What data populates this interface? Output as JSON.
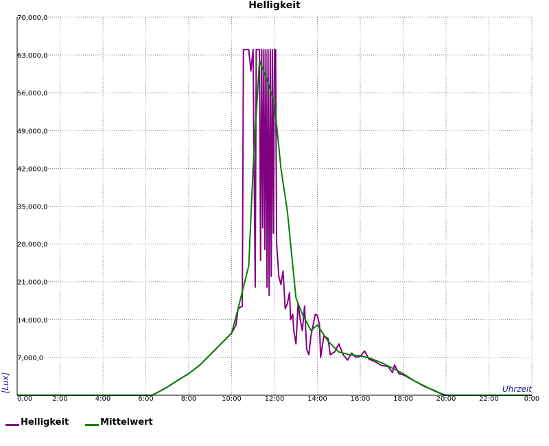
{
  "chart_data": {
    "type": "line",
    "title": "Helligkeit",
    "xlabel": "Uhrzeit",
    "ylabel": "[Lux]",
    "xlim": [
      0,
      24
    ],
    "ylim": [
      0,
      70000
    ],
    "grid": true,
    "legend_position": "bottom-left",
    "y_ticks": [
      "0,00",
      "7,000,0",
      "14,000,0",
      "21,000,0",
      "28,000,0",
      "35,000,0",
      "42,000,0",
      "49,000,0",
      "56,000,0",
      "63,000,0",
      "70,000,0"
    ],
    "x_ticks": [
      "0,00",
      "2:00",
      "4:00",
      "6:00",
      "8:00",
      "10:00",
      "12:00",
      "14:00",
      "16:00",
      "18:00",
      "20:00",
      "22:00",
      "0:00"
    ],
    "series": [
      {
        "name": "Helligkeit",
        "color": "#800080",
        "points": [
          [
            0,
            0
          ],
          [
            6.3,
            0
          ],
          [
            7.0,
            1500
          ],
          [
            7.5,
            2800
          ],
          [
            8.0,
            4000
          ],
          [
            8.5,
            5500
          ],
          [
            9.0,
            7500
          ],
          [
            9.5,
            9500
          ],
          [
            10.0,
            11500
          ],
          [
            10.2,
            13000
          ],
          [
            10.3,
            16000
          ],
          [
            10.5,
            16500
          ],
          [
            10.55,
            64000
          ],
          [
            10.8,
            64000
          ],
          [
            10.9,
            60000
          ],
          [
            11.0,
            64000
          ],
          [
            11.1,
            20000
          ],
          [
            11.15,
            64000
          ],
          [
            11.3,
            64000
          ],
          [
            11.35,
            25000
          ],
          [
            11.4,
            64000
          ],
          [
            11.45,
            31000
          ],
          [
            11.5,
            64000
          ],
          [
            11.55,
            27000
          ],
          [
            11.6,
            64000
          ],
          [
            11.65,
            20000
          ],
          [
            11.7,
            64000
          ],
          [
            11.75,
            18500
          ],
          [
            11.8,
            64000
          ],
          [
            11.85,
            22000
          ],
          [
            11.9,
            64000
          ],
          [
            11.95,
            30000
          ],
          [
            12.0,
            64000
          ],
          [
            12.05,
            64000
          ],
          [
            12.1,
            28000
          ],
          [
            12.2,
            22000
          ],
          [
            12.3,
            20500
          ],
          [
            12.4,
            23000
          ],
          [
            12.5,
            16000
          ],
          [
            12.6,
            17000
          ],
          [
            12.7,
            19000
          ],
          [
            12.75,
            14000
          ],
          [
            12.85,
            15000
          ],
          [
            12.9,
            12000
          ],
          [
            13.0,
            9500
          ],
          [
            13.1,
            17000
          ],
          [
            13.2,
            14000
          ],
          [
            13.3,
            12000
          ],
          [
            13.4,
            16500
          ],
          [
            13.5,
            8500
          ],
          [
            13.6,
            7500
          ],
          [
            13.7,
            11000
          ],
          [
            13.8,
            13000
          ],
          [
            13.9,
            15000
          ],
          [
            14.0,
            14800
          ],
          [
            14.1,
            13000
          ],
          [
            14.15,
            7000
          ],
          [
            14.3,
            11000
          ],
          [
            14.5,
            10500
          ],
          [
            14.6,
            7500
          ],
          [
            14.8,
            8000
          ],
          [
            15.0,
            9500
          ],
          [
            15.2,
            7500
          ],
          [
            15.4,
            6500
          ],
          [
            15.6,
            7800
          ],
          [
            15.8,
            7000
          ],
          [
            16.0,
            7200
          ],
          [
            16.2,
            8200
          ],
          [
            16.4,
            6700
          ],
          [
            16.7,
            6200
          ],
          [
            17.0,
            5500
          ],
          [
            17.3,
            5300
          ],
          [
            17.5,
            4200
          ],
          [
            17.6,
            5600
          ],
          [
            17.8,
            4000
          ],
          [
            18.0,
            3800
          ],
          [
            18.5,
            2700
          ],
          [
            19.0,
            1600
          ],
          [
            19.5,
            800
          ],
          [
            19.9,
            0
          ],
          [
            24,
            0
          ]
        ]
      },
      {
        "name": "Mittelwert",
        "color": "#008000",
        "points": [
          [
            0,
            0
          ],
          [
            6.3,
            0
          ],
          [
            7.0,
            1500
          ],
          [
            7.5,
            2800
          ],
          [
            8.0,
            4000
          ],
          [
            8.5,
            5500
          ],
          [
            9.0,
            7500
          ],
          [
            9.5,
            9500
          ],
          [
            10.0,
            11500
          ],
          [
            10.3,
            16000
          ],
          [
            10.8,
            24000
          ],
          [
            11.0,
            42000
          ],
          [
            11.3,
            62000
          ],
          [
            11.6,
            59000
          ],
          [
            12.0,
            54000
          ],
          [
            12.3,
            42000
          ],
          [
            12.6,
            34000
          ],
          [
            13.0,
            18000
          ],
          [
            13.3,
            15000
          ],
          [
            13.7,
            12000
          ],
          [
            14.0,
            13000
          ],
          [
            14.5,
            10000
          ],
          [
            15.0,
            8000
          ],
          [
            15.5,
            7500
          ],
          [
            16.0,
            7300
          ],
          [
            16.5,
            6800
          ],
          [
            17.0,
            6000
          ],
          [
            17.5,
            5000
          ],
          [
            18.0,
            4000
          ],
          [
            18.5,
            2700
          ],
          [
            19.0,
            1700
          ],
          [
            19.5,
            700
          ],
          [
            20.0,
            0
          ],
          [
            24,
            0
          ]
        ]
      }
    ]
  }
}
